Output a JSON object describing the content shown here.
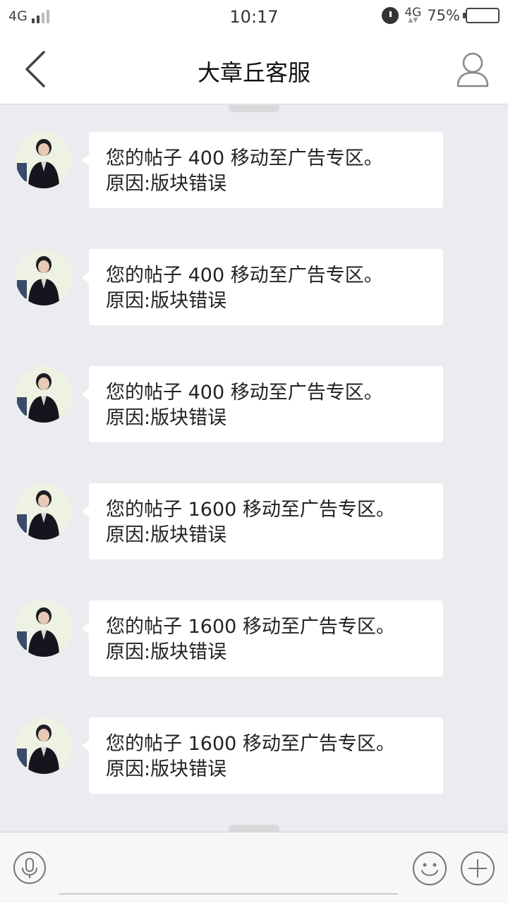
{
  "status_bar": {
    "network_left": "4G",
    "time": "10:17",
    "network_right": "4G",
    "battery_percent_label": "75%",
    "battery_level": 0.75
  },
  "nav": {
    "title": "大章丘客服",
    "back_icon": "chevron-left-icon",
    "profile_icon": "person-icon"
  },
  "messages": [
    {
      "line1": "您的帖子 400 移动至广告专区。",
      "line2": "原因:版块错误"
    },
    {
      "line1": "您的帖子 400 移动至广告专区。",
      "line2": "原因:版块错误"
    },
    {
      "line1": "您的帖子 400 移动至广告专区。",
      "line2": "原因:版块错误"
    },
    {
      "line1": "您的帖子 1600 移动至广告专区。",
      "line2": "原因:版块错误"
    },
    {
      "line1": "您的帖子 1600 移动至广告专区。",
      "line2": "原因:版块错误"
    },
    {
      "line1": "您的帖子 1600 移动至广告专区。",
      "line2": "原因:版块错误"
    }
  ],
  "input": {
    "value": "",
    "voice_icon": "microphone-icon",
    "emoji_icon": "smiley-icon",
    "plus_icon": "plus-circle-icon"
  },
  "colors": {
    "chat_background": "#ebecf0",
    "bubble": "#ffffff",
    "bar": "#ffffff"
  }
}
